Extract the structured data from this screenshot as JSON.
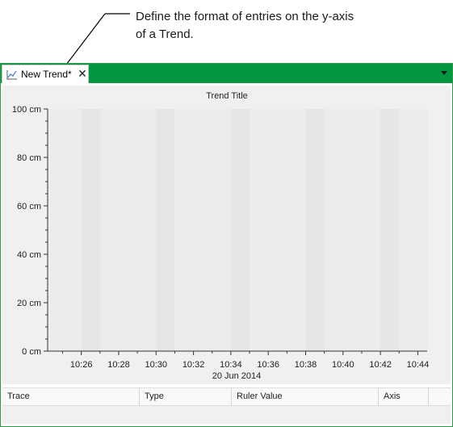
{
  "callout": {
    "lines": [
      "Define the format of entries on the y-axis",
      "of a Trend."
    ]
  },
  "tab": {
    "label": "New Trend*",
    "close_glyph": "✕",
    "icon": "trend-chart-icon"
  },
  "colors": {
    "tabstrip": "#00973f",
    "plot_band_light": "#ececec",
    "plot_band_dark": "#e6e6e6"
  },
  "chart_data": {
    "type": "line",
    "title": "Trend Title",
    "xlabel": "20 Jun 2014",
    "ylabel": "",
    "y_ticks": [
      "0 cm",
      "20 cm",
      "40 cm",
      "60 cm",
      "80 cm",
      "100 cm"
    ],
    "ylim": [
      0,
      100
    ],
    "y_unit": "cm",
    "x_ticks": [
      "10:26",
      "10:28",
      "10:30",
      "10:32",
      "10:34",
      "10:36",
      "10:38",
      "10:40",
      "10:42",
      "10:44"
    ],
    "x_date": "20 Jun 2014",
    "series": []
  },
  "table": {
    "columns": [
      "Trace",
      "Type",
      "Ruler Value",
      "Axis"
    ],
    "rows": []
  }
}
